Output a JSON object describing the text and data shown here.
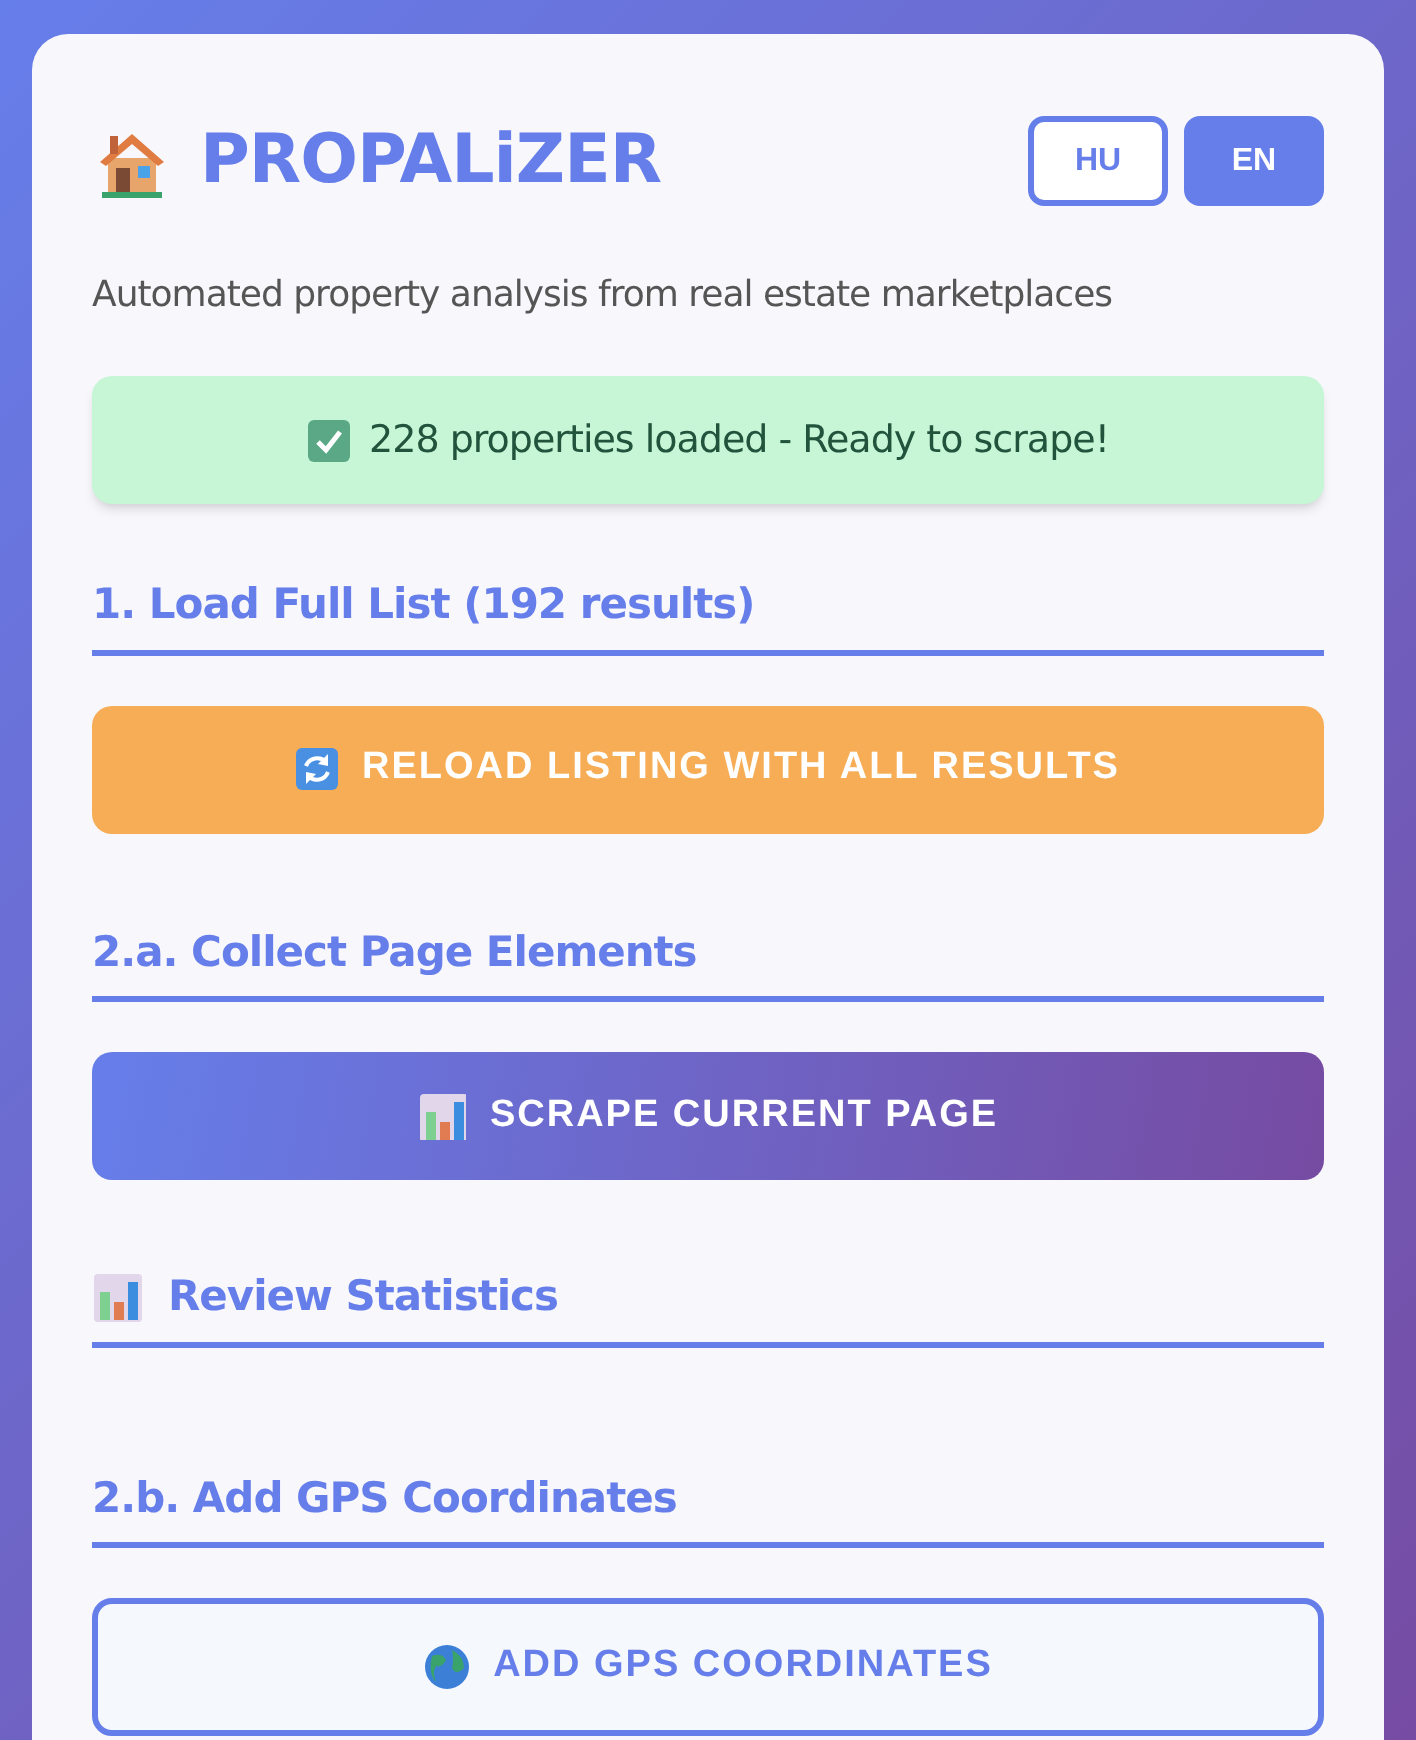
{
  "app": {
    "title": "PROPALiZER",
    "subtitle": "Automated property analysis from real estate marketplaces"
  },
  "languages": [
    {
      "label": "HU",
      "selected": false
    },
    {
      "label": "EN",
      "selected": true
    }
  ],
  "status": {
    "kind": "success",
    "text": "228 properties loaded - Ready to scrape!"
  },
  "sections": [
    {
      "title": "1. Load Full List (192 results)",
      "button": {
        "kind": "reload",
        "label": "RELOAD LISTING WITH ALL RESULTS"
      }
    },
    {
      "title": "2.a. Collect Page Elements",
      "button": {
        "kind": "scrape",
        "label": "SCRAPE CURRENT PAGE"
      }
    },
    {
      "title": "Review Statistics",
      "kind": "stats"
    },
    {
      "title": "2.b. Add GPS Coordinates",
      "button": {
        "kind": "gps",
        "label": "ADD GPS COORDINATES"
      }
    }
  ]
}
